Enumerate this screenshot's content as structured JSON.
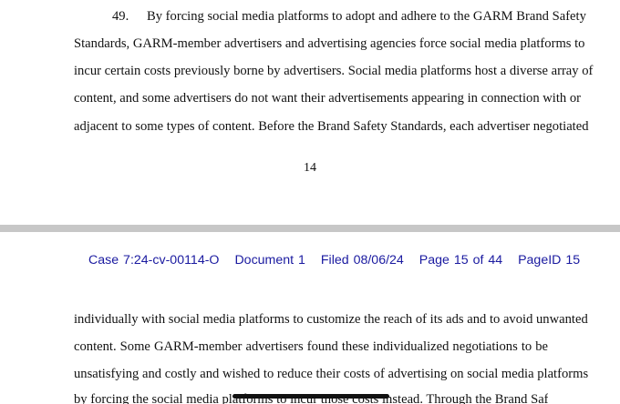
{
  "page_top": {
    "paragraph_number": "49.",
    "lines": [
      "By forcing social media platforms to adopt and adhere to the GARM Brand Safety",
      "Standards, GARM-member advertisers and advertising agencies force social media platforms to",
      "incur certain costs previously borne by advertisers.  Social media platforms host a diverse array of",
      "content, and some advertisers do not want their advertisements appearing in connection with or",
      "adjacent to some types of content.  Before the Brand Safety Standards, each advertiser negotiated"
    ],
    "page_number": "14"
  },
  "page_bottom": {
    "header": {
      "case": "Case 7:24-cv-00114-O",
      "document": "Document 1",
      "filed": "Filed 08/06/24",
      "page": "Page 15 of 44",
      "page_id": "PageID 15"
    },
    "lines": [
      "individually with social media platforms to customize the reach of its ads and to avoid unwanted",
      "content.   Some GARM-member advertisers found these individualized negotiations to be",
      "unsatisfying and costly and wished to reduce their costs of advertising on social media platforms",
      "by forcing the social media platforms to incur those costs instead.  Through the Brand Safety"
    ]
  }
}
